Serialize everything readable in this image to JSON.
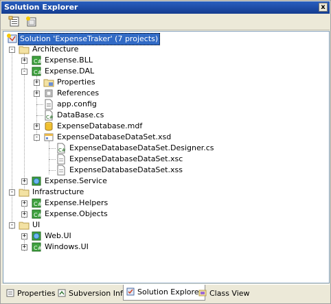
{
  "window": {
    "title": "Solution Explorer",
    "close_glyph": "x"
  },
  "toolbar": {
    "buttons": [
      "properties-icon",
      "show-all-files-icon"
    ]
  },
  "tree": {
    "solution": "Solution 'ExpenseTraker' (7 projects)",
    "items": [
      {
        "label": "Architecture",
        "icon": "folder-icon"
      },
      {
        "label": "Expense.BLL",
        "icon": "csharp-project-icon"
      },
      {
        "label": "Expense.DAL",
        "icon": "csharp-project-icon"
      },
      {
        "label": "Properties",
        "icon": "properties-folder-icon"
      },
      {
        "label": "References",
        "icon": "references-icon"
      },
      {
        "label": "app.config",
        "icon": "config-file-icon"
      },
      {
        "label": "DataBase.cs",
        "icon": "csharp-file-icon"
      },
      {
        "label": "ExpenseDatabase.mdf",
        "icon": "database-icon"
      },
      {
        "label": "ExpenseDatabaseDataSet.xsd",
        "icon": "dataset-icon"
      },
      {
        "label": "ExpenseDatabaseDataSet.Designer.cs",
        "icon": "csharp-file-icon"
      },
      {
        "label": "ExpenseDatabaseDataSet.xsc",
        "icon": "file-icon"
      },
      {
        "label": "ExpenseDatabaseDataSet.xss",
        "icon": "file-icon"
      },
      {
        "label": "Expense.Service",
        "icon": "web-project-icon"
      },
      {
        "label": "Infrastructure",
        "icon": "folder-icon"
      },
      {
        "label": "Expense.Helpers",
        "icon": "csharp-project-icon"
      },
      {
        "label": "Expense.Objects",
        "icon": "csharp-project-icon"
      },
      {
        "label": "UI",
        "icon": "folder-icon"
      },
      {
        "label": "Web.UI",
        "icon": "web-project-icon"
      },
      {
        "label": "Windows.UI",
        "icon": "csharp-project-icon"
      }
    ]
  },
  "tabs": [
    {
      "label": "Properties",
      "icon": "properties-tab-icon"
    },
    {
      "label": "Subversion Info",
      "icon": "subversion-icon"
    },
    {
      "label": "Solution Explorer",
      "icon": "solution-explorer-icon",
      "active": true
    },
    {
      "label": "Class View",
      "icon": "class-view-icon"
    }
  ],
  "colors": {
    "selection": "#316ac5",
    "titlebar": "#1c4aa3",
    "panel": "#ece9d8"
  }
}
